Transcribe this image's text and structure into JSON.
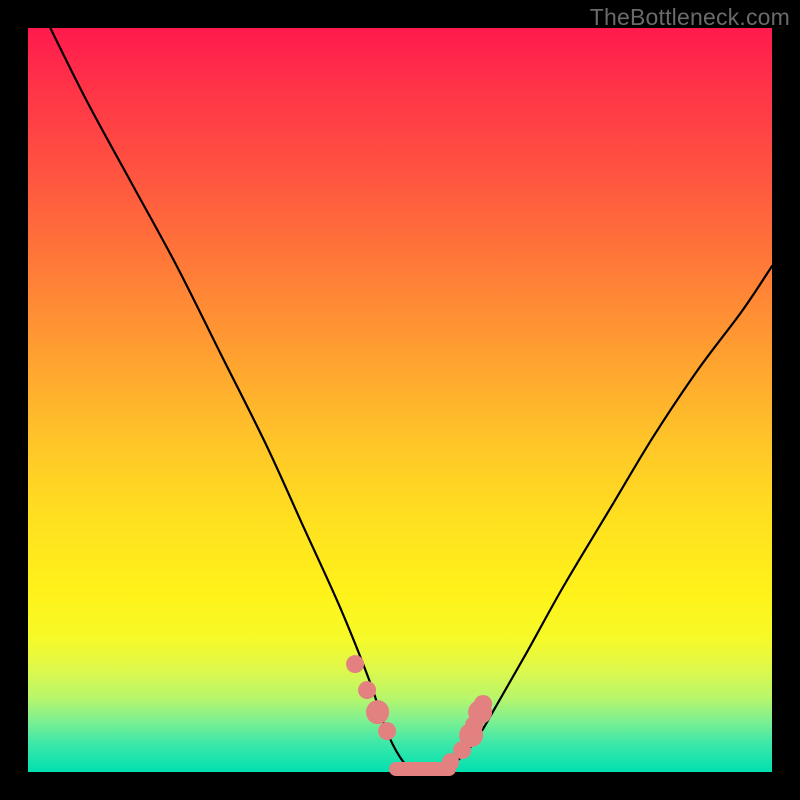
{
  "watermark": "TheBottleneck.com",
  "colors": {
    "frame": "#000000",
    "curve": "#000000",
    "marker": "#e38080",
    "gradient_top": "#ff1a4d",
    "gradient_bottom": "#00e0b0"
  },
  "chart_data": {
    "type": "line",
    "title": "",
    "xlabel": "",
    "ylabel": "",
    "xlim": [
      0,
      100
    ],
    "ylim": [
      0,
      100
    ],
    "grid": false,
    "legend": false,
    "note": "Bottleneck curve: y-value is approximate bottleneck percentage (0 = no bottleneck at valley). Read back from pixel positions; no axis ticks shown.",
    "series": [
      {
        "name": "bottleneck-curve",
        "x": [
          3,
          8,
          14,
          20,
          26,
          32,
          37,
          42,
          46,
          48,
          50,
          52,
          54,
          57,
          60,
          63,
          67,
          72,
          78,
          84,
          90,
          96,
          100
        ],
        "y": [
          100,
          90,
          79,
          68,
          56,
          44,
          33,
          22,
          12,
          6,
          2,
          0,
          0,
          1,
          4,
          9,
          16,
          25,
          35,
          45,
          54,
          62,
          68
        ]
      }
    ],
    "markers": [
      {
        "x": 44.0,
        "y": 14.5,
        "r": 1.2
      },
      {
        "x": 45.6,
        "y": 11.0,
        "r": 1.2
      },
      {
        "x": 47.0,
        "y": 8.0,
        "r": 1.6
      },
      {
        "x": 48.3,
        "y": 5.5,
        "r": 1.2
      },
      {
        "x": 56.8,
        "y": 1.3,
        "r": 1.2
      },
      {
        "x": 58.3,
        "y": 3.0,
        "r": 1.2
      },
      {
        "x": 59.6,
        "y": 5.0,
        "r": 1.6
      },
      {
        "x": 60.0,
        "y": 6.3,
        "r": 1.2
      },
      {
        "x": 60.8,
        "y": 8.0,
        "r": 1.6
      },
      {
        "x": 61.2,
        "y": 9.2,
        "r": 1.2
      }
    ],
    "valley_bar": {
      "x_start": 48.5,
      "x_end": 57.5,
      "y": 0.4,
      "thickness": 2.0
    }
  }
}
